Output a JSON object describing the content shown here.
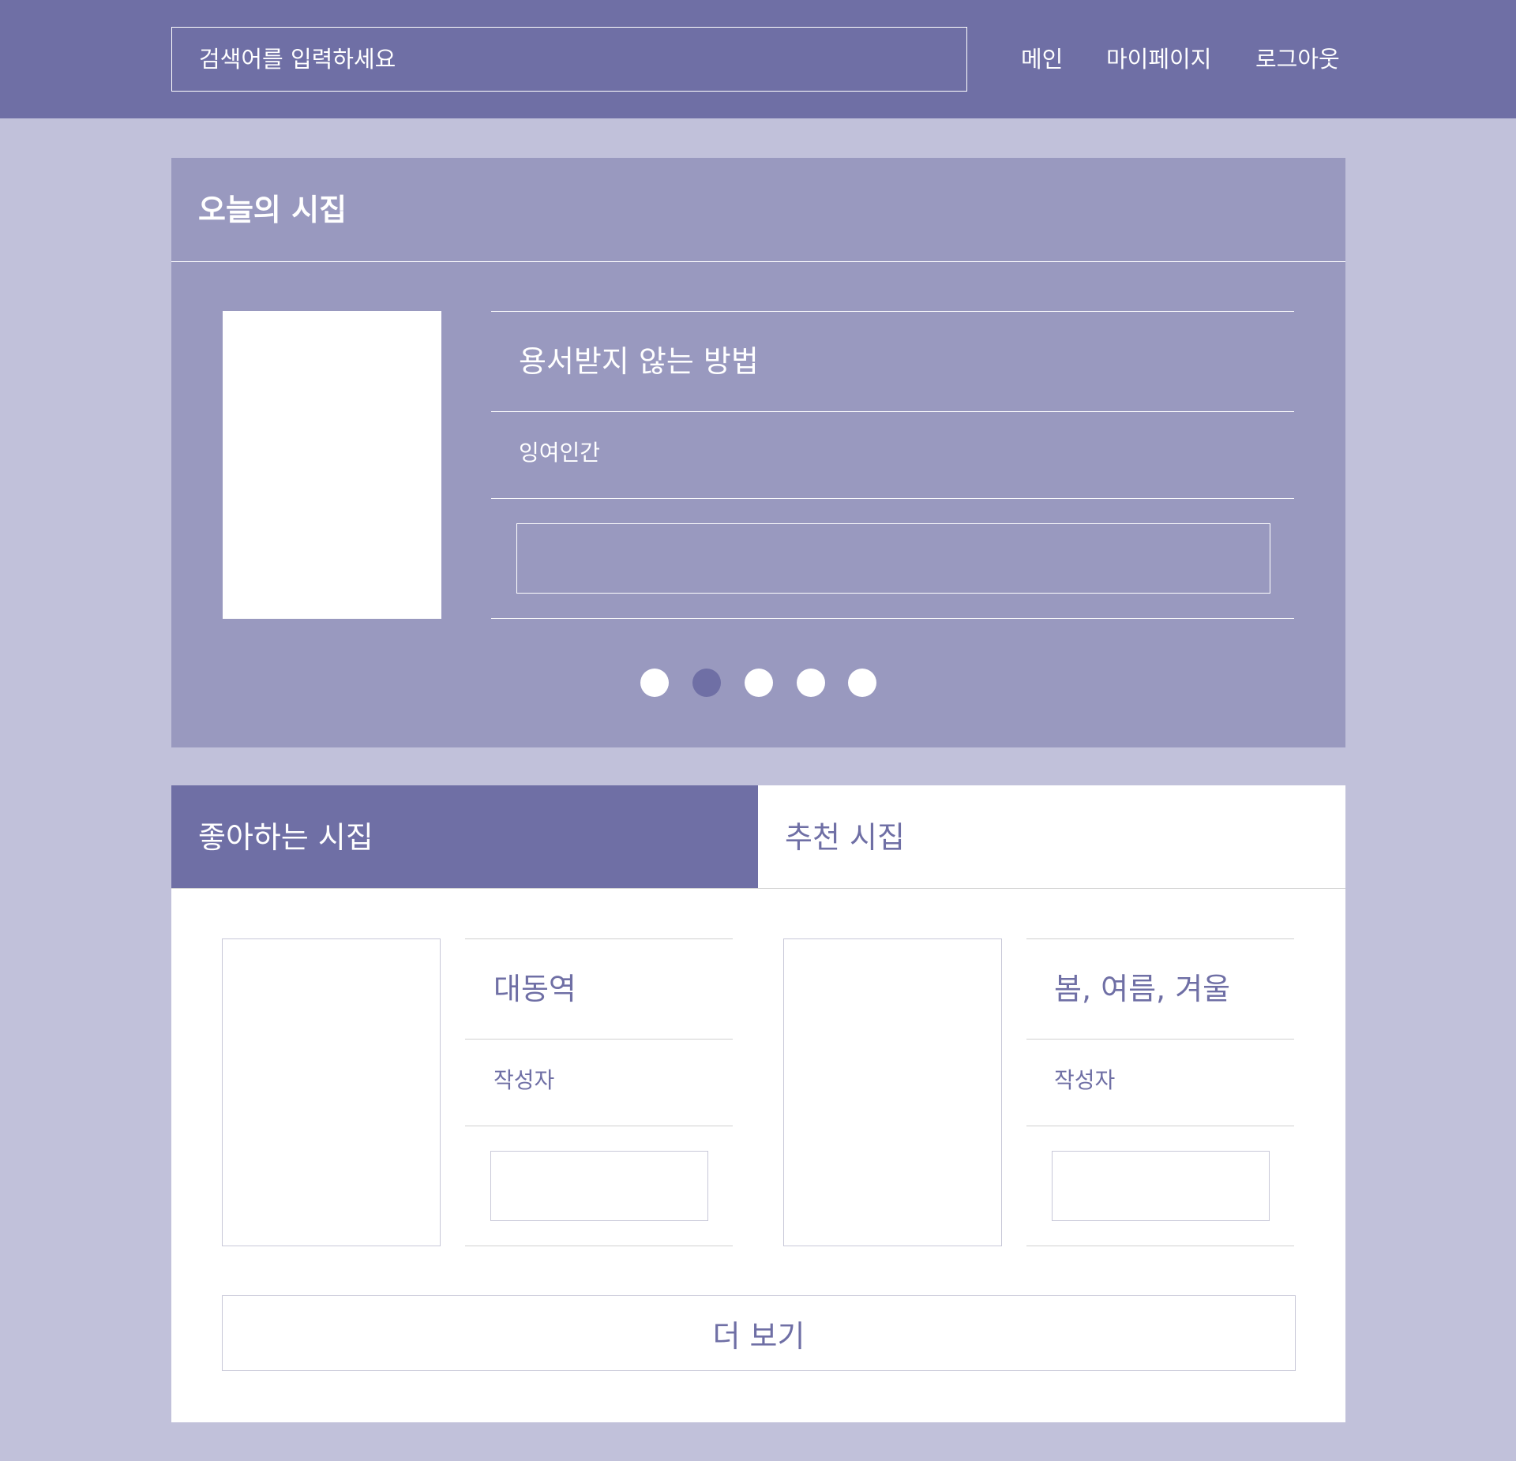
{
  "header": {
    "search_placeholder": "검색어를 입력하세요",
    "nav": {
      "main": "메인",
      "mypage": "마이페이지",
      "logout": "로그아웃"
    }
  },
  "today": {
    "title": "오늘의 시집",
    "poem_title": "용서받지 않는 방법",
    "author": "잉여인간",
    "carousel_active_index": 2,
    "carousel_count": 5
  },
  "tabs": {
    "liked": "좋아하는 시집",
    "recommended": "추천 시집",
    "active": "liked"
  },
  "cards": [
    {
      "title": "대동역",
      "author": "작성자"
    },
    {
      "title": "봄, 여름, 겨울",
      "author": "작성자"
    }
  ],
  "more_label": "더 보기",
  "colors": {
    "page_bg": "#c1c1da",
    "header_bg": "#6f6fa5",
    "today_bg": "#9999bf",
    "accent": "#6f6fa5",
    "white": "#ffffff"
  }
}
